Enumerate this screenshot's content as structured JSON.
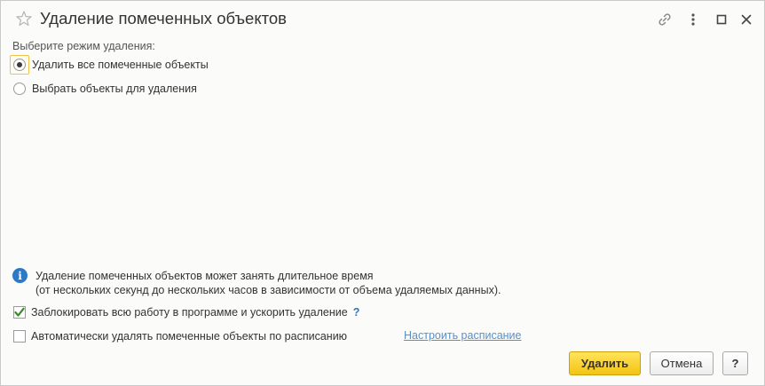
{
  "window": {
    "title": "Удаление помеченных объектов",
    "icons": {
      "favorite": "star-icon",
      "link": "link-icon",
      "more": "more-vertical-icon",
      "maximize": "maximize-icon",
      "close": "close-icon"
    }
  },
  "mode": {
    "label": "Выберите режим удаления:",
    "options": [
      {
        "label": "Удалить все помеченные объекты",
        "selected": true
      },
      {
        "label": "Выбрать объекты для удаления",
        "selected": false
      }
    ]
  },
  "info": {
    "icon": "info-icon",
    "line1": "Удаление помеченных объектов может занять длительное время",
    "line2": "(от нескольких секунд до нескольких часов в зависимости от объема удаляемых данных)."
  },
  "options": {
    "lock_work": {
      "label": "Заблокировать всю работу в программе и ускорить удаление",
      "checked": true,
      "help": "?"
    },
    "auto_delete": {
      "label": "Автоматически удалять помеченные объекты по расписанию",
      "checked": false
    },
    "schedule_link": "Настроить расписание"
  },
  "buttons": {
    "delete": "Удалить",
    "cancel": "Отмена",
    "help": "?"
  },
  "colors": {
    "accent_blue": "#2c79c8",
    "primary_button": "#f3c313",
    "focus_border": "#f2c14a"
  }
}
